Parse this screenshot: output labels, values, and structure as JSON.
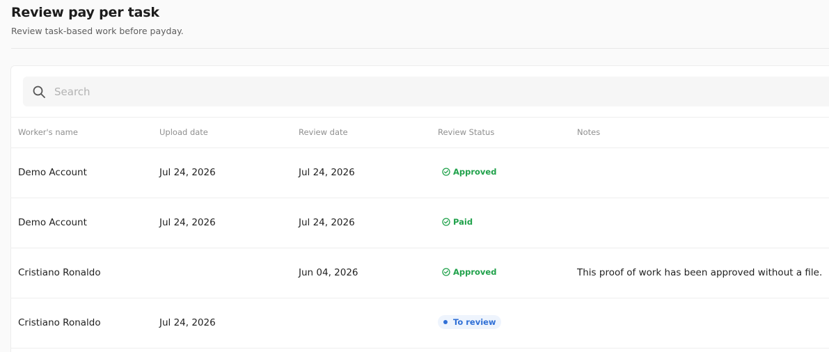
{
  "header": {
    "title": "Review pay per task",
    "subtitle": "Review task-based work before payday."
  },
  "search": {
    "placeholder": "Search",
    "value": "",
    "icon": "search-icon"
  },
  "table": {
    "columns": [
      "Worker's name",
      "Upload date",
      "Review date",
      "Review Status",
      "Notes"
    ],
    "rows": [
      {
        "worker": "Demo Account",
        "upload_date": "Jul 24, 2026",
        "review_date": "Jul 24, 2026",
        "status": "Approved",
        "notes": ""
      },
      {
        "worker": "Demo Account",
        "upload_date": "Jul 24, 2026",
        "review_date": "Jul 24, 2026",
        "status": "Paid",
        "notes": ""
      },
      {
        "worker": "Cristiano Ronaldo",
        "upload_date": "",
        "review_date": "Jun 04, 2026",
        "status": "Approved",
        "notes": "This proof of work has been approved without a file."
      },
      {
        "worker": "Cristiano Ronaldo",
        "upload_date": "Jul 24, 2026",
        "review_date": "",
        "status": "To review",
        "notes": ""
      }
    ]
  },
  "colors": {
    "status_success": "#1fa14a",
    "status_pending": "#2f6fd6",
    "status_pending_bg": "#eef4fd"
  }
}
